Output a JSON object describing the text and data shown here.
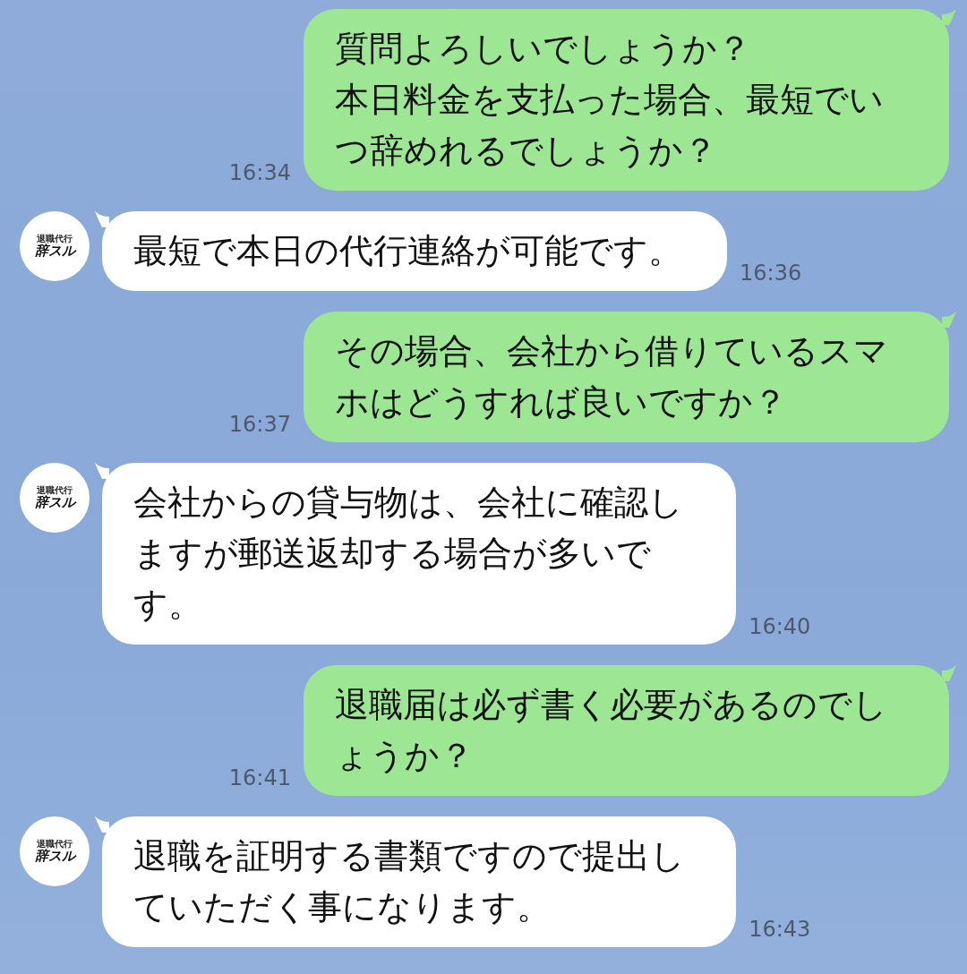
{
  "messages": [
    {
      "kind": "sent",
      "paragraphs": [
        "質問よろしいでしょうか？",
        "本日料金を支払った場合、最短でいつ辞めれるでしょうか？"
      ],
      "time": "16:34"
    },
    {
      "kind": "received",
      "avatar": {
        "logo_small": "退職代行",
        "logo_large": "辞スル"
      },
      "paragraphs": [
        "最短で本日の代行連絡が可能です。"
      ],
      "time": "16:36"
    },
    {
      "kind": "sent",
      "paragraphs": [
        "その場合、会社から借りているスマホはどうすれば良いですか？"
      ],
      "time": "16:37"
    },
    {
      "kind": "received",
      "avatar": {
        "logo_small": "退職代行",
        "logo_large": "辞スル"
      },
      "paragraphs": [
        "会社からの貸与物は、会社に確認しますが郵送返却する場合が多いです。"
      ],
      "time": "16:40"
    },
    {
      "kind": "sent",
      "paragraphs": [
        "退職届は必ず書く必要があるのでしょうか？"
      ],
      "time": "16:41"
    },
    {
      "kind": "received",
      "avatar": {
        "logo_small": "退職代行",
        "logo_large": "辞スル"
      },
      "paragraphs": [
        "退職を証明する書類ですので提出していただく事になります。"
      ],
      "time": "16:43"
    }
  ]
}
